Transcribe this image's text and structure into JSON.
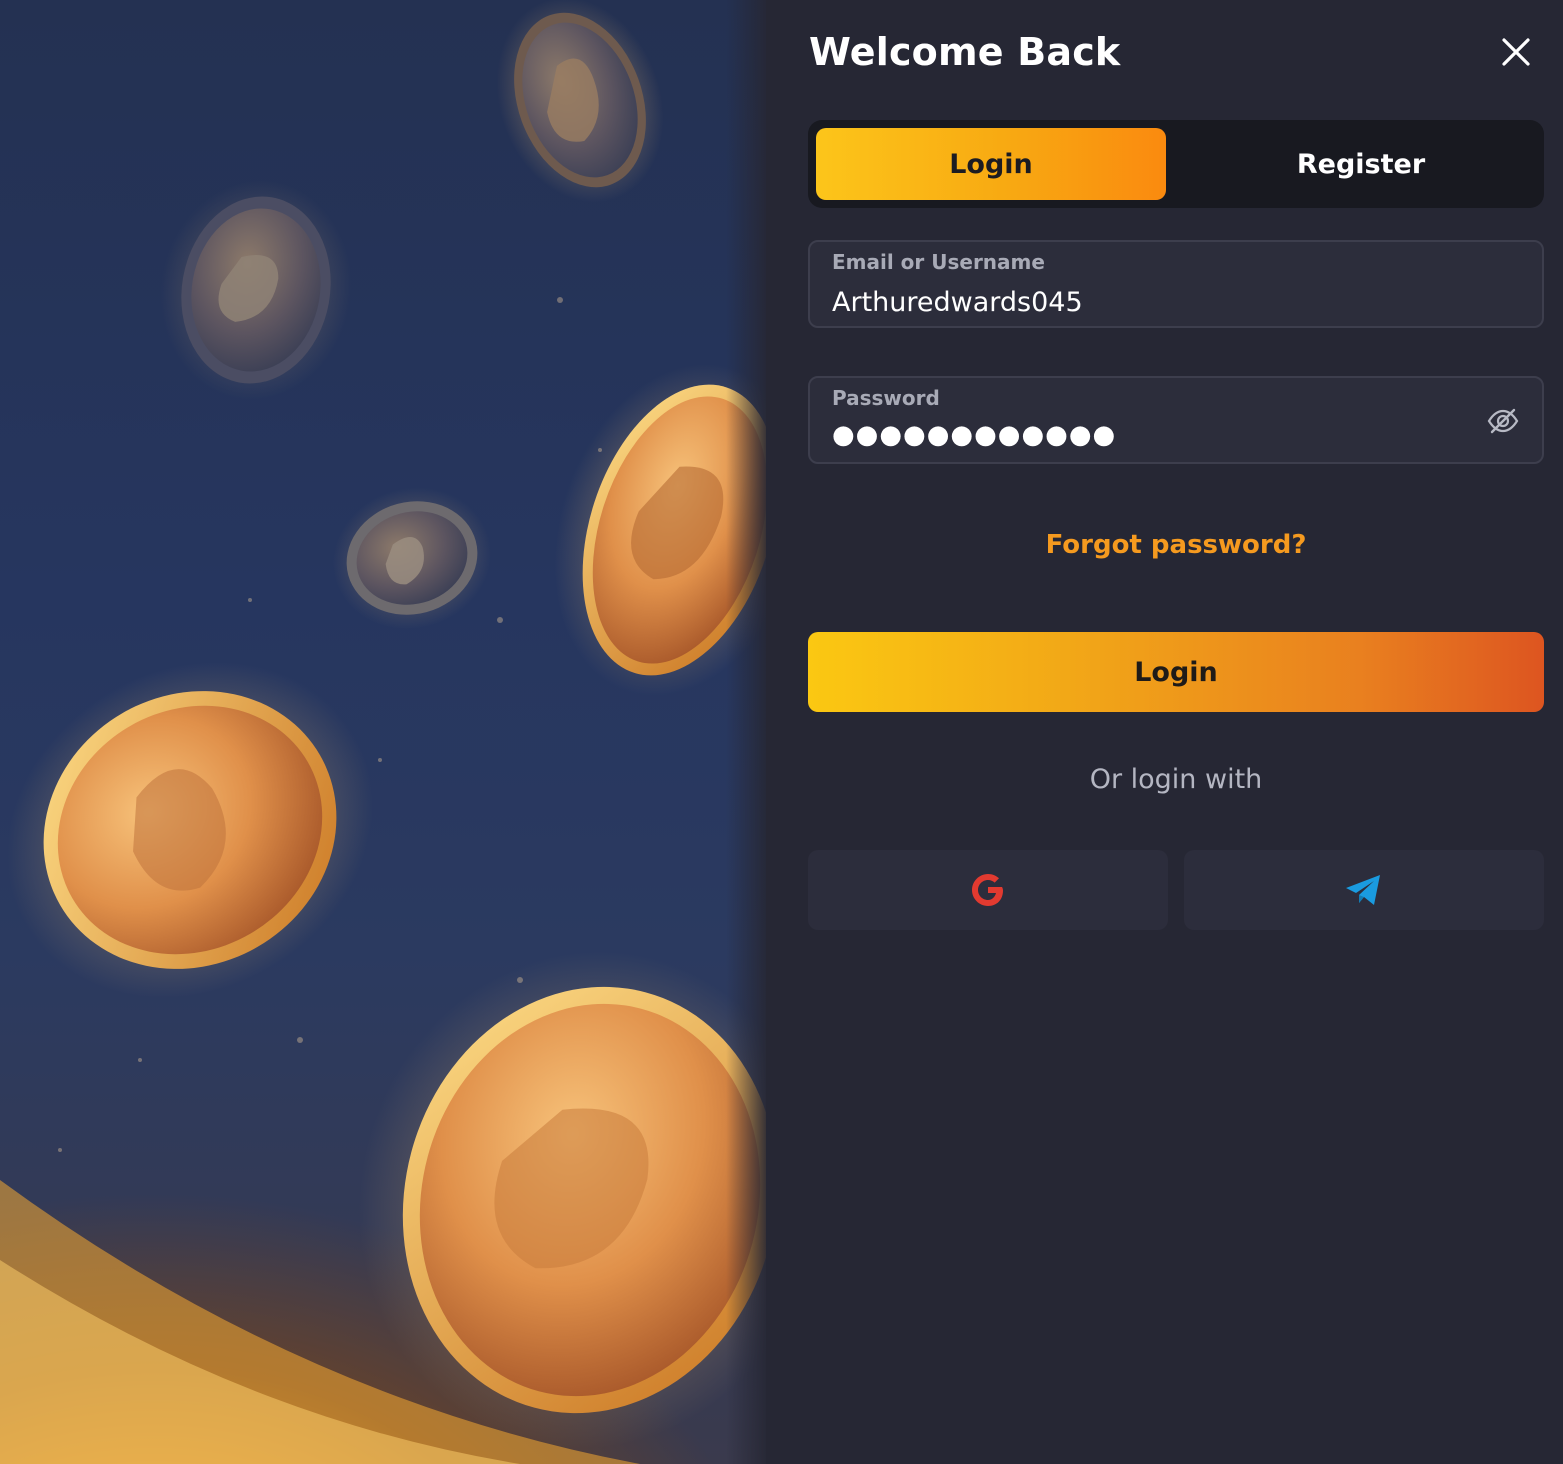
{
  "dialog": {
    "title": "Welcome Back",
    "close_icon": "close-icon"
  },
  "tabs": [
    {
      "label": "Login",
      "active": true
    },
    {
      "label": "Register",
      "active": false
    }
  ],
  "form": {
    "username": {
      "label": "Email or Username",
      "value": "Arthuredwards045"
    },
    "password": {
      "label": "Password",
      "masked_value": "●●●●●●●●●●●●",
      "toggle_icon": "eye-off-icon"
    },
    "forgot_link": "Forgot password?",
    "submit_label": "Login"
  },
  "social": {
    "heading": "Or login with",
    "providers": [
      {
        "name": "google",
        "icon": "google-icon",
        "color": "#e23a30"
      },
      {
        "name": "telegram",
        "icon": "telegram-icon",
        "color": "#1a9be0"
      }
    ]
  },
  "colors": {
    "accent_start": "#fcc51a",
    "accent_end": "#dd5520",
    "link": "#f59a1f",
    "panel_bg": "#262734"
  }
}
